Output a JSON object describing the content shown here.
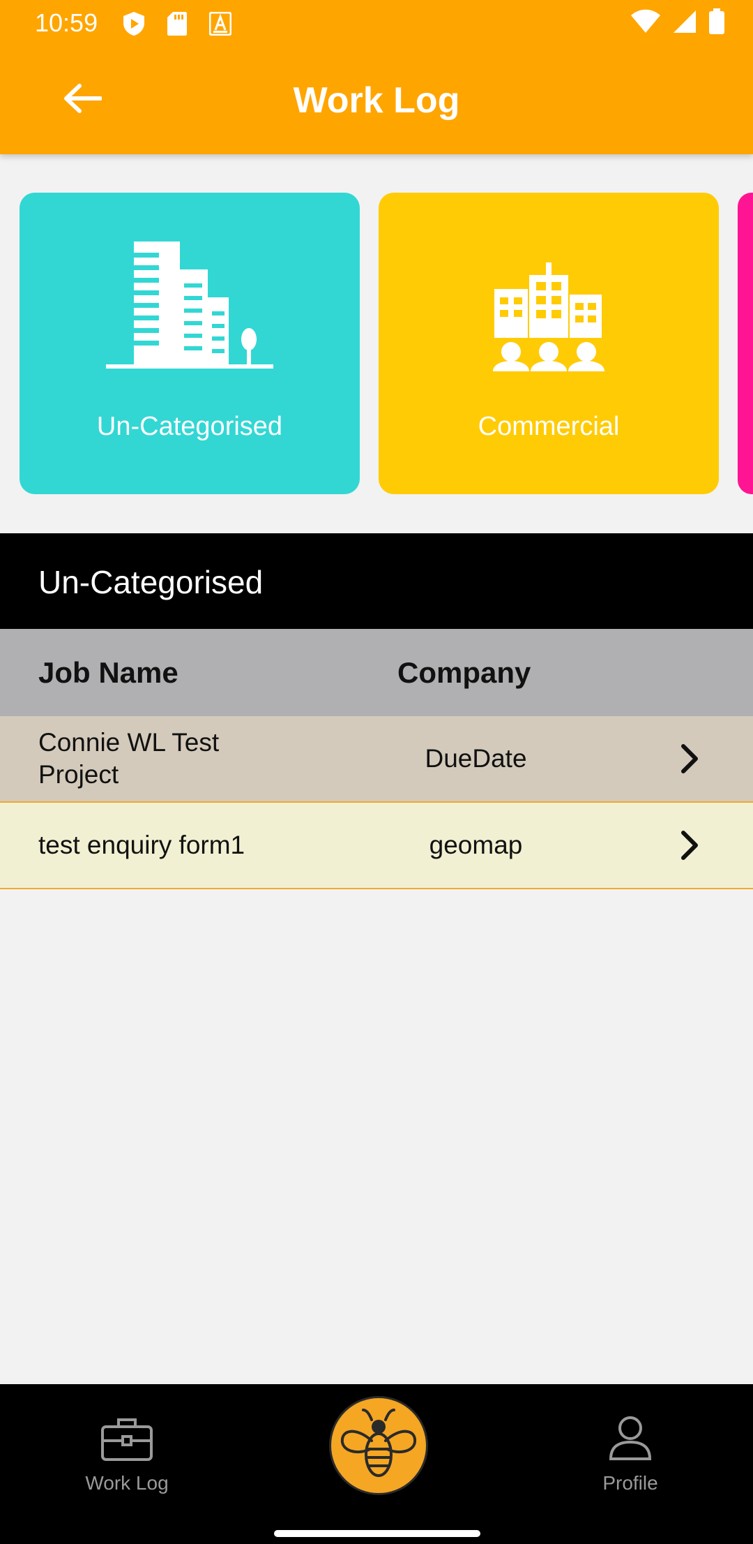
{
  "status_bar": {
    "time": "10:59",
    "left_icons": [
      "shield-play-icon",
      "sd-card-icon",
      "font-icon"
    ],
    "right_icons": [
      "wifi-icon",
      "signal-icon",
      "battery-icon"
    ]
  },
  "app_bar": {
    "title": "Work Log",
    "back_icon": "arrow-left-icon",
    "color": "#ffa500"
  },
  "categories": [
    {
      "label": "Un-Categorised",
      "icon": "buildings-icon",
      "color": "#32d7d4"
    },
    {
      "label": "Commercial",
      "icon": "commercial-buildings-icon",
      "color": "#ffcb05"
    },
    {
      "label": "",
      "icon": "",
      "color": "#ff1493"
    }
  ],
  "section": {
    "title": "Un-Categorised"
  },
  "table": {
    "headers": {
      "job_name": "Job Name",
      "company": "Company"
    },
    "rows": [
      {
        "job_name": "Connie WL Test Project",
        "company": "DueDate",
        "icon": "chevron-right-icon"
      },
      {
        "job_name": "test enquiry form1",
        "company": "geomap",
        "icon": "chevron-right-icon"
      }
    ]
  },
  "bottom_nav": {
    "items": [
      {
        "label": "Work Log",
        "icon": "briefcase-icon"
      },
      {
        "label": "",
        "icon": "bee-icon"
      },
      {
        "label": "Profile",
        "icon": "person-icon"
      }
    ]
  }
}
